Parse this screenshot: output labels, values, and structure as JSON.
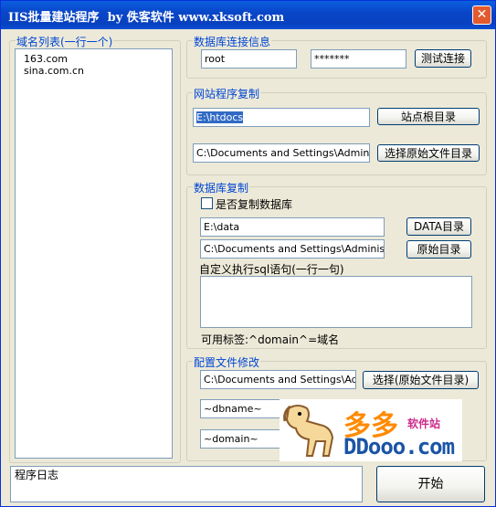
{
  "window": {
    "title": "IIS批量建站程序  by 佚客软件 www.xksoft.com"
  },
  "domain_list": {
    "legend": "域名列表(一行一个)",
    "items": [
      "163.com",
      "sina.com.cn"
    ]
  },
  "db_connection": {
    "legend": "数据库连接信息",
    "user": "root",
    "password": "*******",
    "test_button": "测试连接"
  },
  "site_copy": {
    "legend": "网站程序复制",
    "root_path": "E:\\htdocs",
    "root_button": "站点根目录",
    "source_path": "C:\\Documents and Settings\\Administrat",
    "source_button": "选择原始文件目录"
  },
  "db_copy": {
    "legend": "数据库复制",
    "checkbox_label": "是否复制数据库",
    "data_path": "E:\\data",
    "data_button": "DATA目录",
    "source_path": "C:\\Documents and Settings\\Administrato",
    "source_button": "原始目录",
    "sql_label": "自定义执行sql语句(一行一句)",
    "sql_text": "",
    "tag_hint": "可用标签:^domain^=域名"
  },
  "config_edit": {
    "legend": "配置文件修改",
    "config_path": "C:\\Documents and Settings\\Admin",
    "config_button": "选择(原始文件目录)",
    "dbname": "~dbname~",
    "domain": "~domain~"
  },
  "log": {
    "placeholder": "程序日志"
  },
  "start_button": "开始",
  "watermark": {
    "text1": "多多",
    "text2": "软件站",
    "text3": "DDooo.com"
  }
}
